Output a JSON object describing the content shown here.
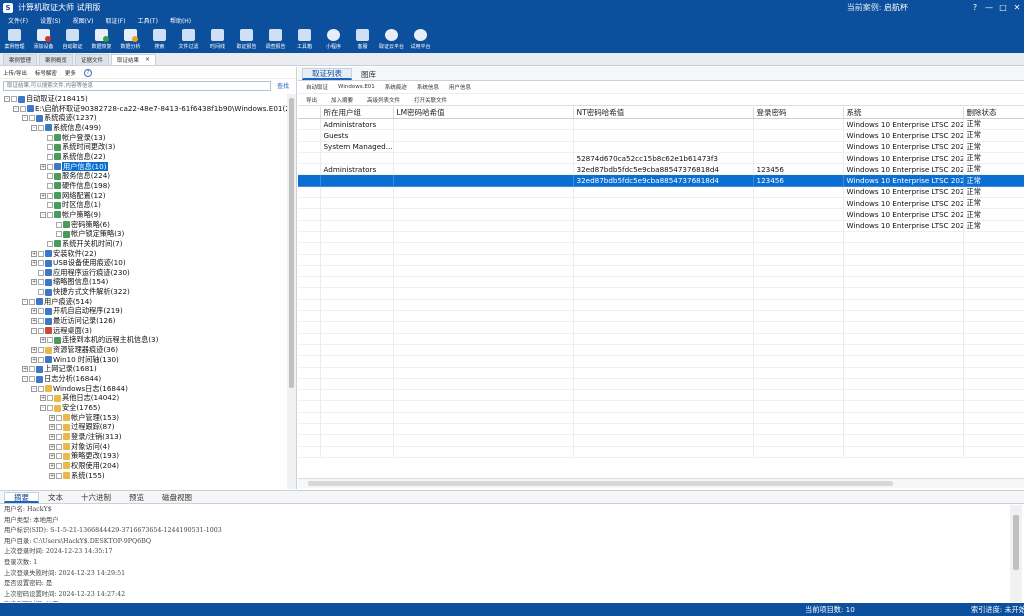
{
  "app": {
    "title": "计算机取证大师 试用版",
    "logo_letter": "S",
    "current_case_label": "当前案例:",
    "current_case_value": "启航杯",
    "window_buttons": [
      "?",
      "—",
      "□",
      "✕"
    ]
  },
  "menu": [
    "文件(F)",
    "设置(S)",
    "视图(V)",
    "取证(F)",
    "工具(T)",
    "帮助(H)"
  ],
  "toolbar": [
    {
      "label": "案例管理",
      "icon": "case-manage-icon",
      "variant": "b"
    },
    {
      "label": "添加设备",
      "icon": "add-device-icon",
      "variant": "r"
    },
    {
      "label": "自动取证",
      "icon": "auto-forensics-icon",
      "variant": "b"
    },
    {
      "label": "数据恢复",
      "icon": "data-recovery-icon",
      "variant": "g"
    },
    {
      "label": "数据分析",
      "icon": "data-analysis-icon",
      "variant": "o"
    },
    {
      "label": "搜索",
      "icon": "search-icon",
      "variant": "b"
    },
    {
      "label": "文件过滤",
      "icon": "file-filter-icon",
      "variant": "b"
    },
    {
      "label": "时间线",
      "icon": "timeline-icon",
      "variant": "b"
    },
    {
      "label": "取证报告",
      "icon": "forensics-report-icon",
      "variant": "b"
    },
    {
      "label": "调查报告",
      "icon": "investigation-report-icon",
      "variant": "b"
    },
    {
      "label": "工具箱",
      "icon": "toolbox-icon",
      "variant": "b"
    },
    {
      "label": "小程序",
      "icon": "mini-program-icon",
      "variant": "c"
    },
    {
      "label": "客服",
      "icon": "customer-service-icon",
      "variant": "b"
    },
    {
      "label": "取证云平台",
      "icon": "cloud-platform-icon",
      "variant": "c"
    },
    {
      "label": "试用平台",
      "icon": "trial-platform-icon",
      "variant": "c"
    }
  ],
  "doc_tabs": [
    {
      "label": "案例管理",
      "active": false
    },
    {
      "label": "案例概览",
      "active": false
    },
    {
      "label": "证据文件",
      "active": false
    },
    {
      "label": "取证结果",
      "active": true
    }
  ],
  "left_panel": {
    "tools": [
      "上传/导出",
      "标号解密",
      "更多"
    ],
    "search_placeholder": "取证结果,可以搜索文件,内容等信息",
    "search_button": "查找",
    "tree": [
      {
        "depth": 0,
        "ex": "-",
        "icon": "b",
        "label": "自动取证(218415)"
      },
      {
        "depth": 1,
        "ex": "-",
        "icon": "b",
        "label": "E:\\启航杯取证90382728-ca22-48e7-8413-61f6438f1b90\\Windows.E01(21"
      },
      {
        "depth": 2,
        "ex": "-",
        "icon": "b",
        "label": "系统痕迹(1237)"
      },
      {
        "depth": 3,
        "ex": "-",
        "icon": "b",
        "label": "系统信息(499)"
      },
      {
        "depth": 4,
        "ex": "",
        "icon": "g",
        "label": "帐户登录(13)"
      },
      {
        "depth": 4,
        "ex": "",
        "icon": "g",
        "label": "系统时间更改(3)"
      },
      {
        "depth": 4,
        "ex": "",
        "icon": "g",
        "label": "系统信息(22)"
      },
      {
        "depth": 4,
        "ex": "+",
        "icon": "b",
        "label": "用户信息(10)",
        "selected": true
      },
      {
        "depth": 4,
        "ex": "",
        "icon": "g",
        "label": "服务信息(224)"
      },
      {
        "depth": 4,
        "ex": "",
        "icon": "g",
        "label": "硬件信息(198)"
      },
      {
        "depth": 4,
        "ex": "+",
        "icon": "g",
        "label": "网络配置(12)"
      },
      {
        "depth": 4,
        "ex": "",
        "icon": "g",
        "label": "时区信息(1)"
      },
      {
        "depth": 4,
        "ex": "-",
        "icon": "g",
        "label": "帐户策略(9)"
      },
      {
        "depth": 5,
        "ex": "",
        "icon": "g",
        "label": "密码策略(6)"
      },
      {
        "depth": 5,
        "ex": "",
        "icon": "g",
        "label": "帐户锁定策略(3)"
      },
      {
        "depth": 4,
        "ex": "",
        "icon": "g",
        "label": "系统开关机时间(7)"
      },
      {
        "depth": 3,
        "ex": "+",
        "icon": "b",
        "label": "安装软件(22)"
      },
      {
        "depth": 3,
        "ex": "+",
        "icon": "b",
        "label": "USB设备使用痕迹(10)"
      },
      {
        "depth": 3,
        "ex": "",
        "icon": "b",
        "label": "应用程序运行痕迹(230)"
      },
      {
        "depth": 3,
        "ex": "+",
        "icon": "b",
        "label": "缩略图信息(154)"
      },
      {
        "depth": 3,
        "ex": "",
        "icon": "b",
        "label": "快捷方式文件解析(322)"
      },
      {
        "depth": 2,
        "ex": "-",
        "icon": "b",
        "label": "用户痕迹(514)"
      },
      {
        "depth": 3,
        "ex": "+",
        "icon": "b",
        "label": "开机自启动程序(219)"
      },
      {
        "depth": 3,
        "ex": "+",
        "icon": "b",
        "label": "最近访问记录(126)"
      },
      {
        "depth": 3,
        "ex": "-",
        "icon": "r",
        "label": "远程桌面(3)"
      },
      {
        "depth": 4,
        "ex": "+",
        "icon": "g",
        "label": "连接到本机的远程主机信息(3)"
      },
      {
        "depth": 3,
        "ex": "+",
        "icon": "y",
        "label": "资源管理器痕迹(36)"
      },
      {
        "depth": 3,
        "ex": "+",
        "icon": "b",
        "label": "Win10 时间轴(130)"
      },
      {
        "depth": 2,
        "ex": "+",
        "icon": "b",
        "label": "上网记录(1681)"
      },
      {
        "depth": 2,
        "ex": "-",
        "icon": "b",
        "label": "日志分析(16844)"
      },
      {
        "depth": 3,
        "ex": "-",
        "icon": "y",
        "label": "Windows日志(16844)"
      },
      {
        "depth": 4,
        "ex": "+",
        "icon": "y",
        "label": "其他日志(14042)"
      },
      {
        "depth": 4,
        "ex": "-",
        "icon": "y",
        "label": "安全(1765)"
      },
      {
        "depth": 5,
        "ex": "+",
        "icon": "y",
        "label": "帐户管理(153)"
      },
      {
        "depth": 5,
        "ex": "+",
        "icon": "y",
        "label": "过程跟踪(87)"
      },
      {
        "depth": 5,
        "ex": "+",
        "icon": "y",
        "label": "登录/注销(313)"
      },
      {
        "depth": 5,
        "ex": "+",
        "icon": "y",
        "label": "对象访问(4)"
      },
      {
        "depth": 5,
        "ex": "+",
        "icon": "y",
        "label": "策略更改(193)"
      },
      {
        "depth": 5,
        "ex": "+",
        "icon": "y",
        "label": "权限使用(204)"
      },
      {
        "depth": 5,
        "ex": "+",
        "icon": "y",
        "label": "系统(155)"
      }
    ]
  },
  "right_panel": {
    "tabs": [
      {
        "label": "取证列表",
        "active": true
      },
      {
        "label": "图库",
        "active": false
      }
    ],
    "breadcrumb": [
      "自动取证",
      "Windows.E01",
      "系统痕迹",
      "系统信息",
      "用户信息"
    ],
    "grid_tools": [
      "导出",
      "加入摘要",
      "高级列表文件",
      "打开关联文件"
    ],
    "columns": [
      "所在用户组",
      "LM密码哈希值",
      "NT密码哈希值",
      "登录密码",
      "系统",
      "删除状态"
    ],
    "rows": [
      {
        "cells": [
          "Administrators",
          "",
          "",
          "",
          "Windows 10 Enterprise LTSC 2021",
          "正常"
        ],
        "selected": false
      },
      {
        "cells": [
          "Guests",
          "",
          "",
          "",
          "Windows 10 Enterprise LTSC 2021",
          "正常"
        ],
        "selected": false
      },
      {
        "cells": [
          "System Managed...",
          "",
          "",
          "",
          "Windows 10 Enterprise LTSC 2021",
          "正常"
        ],
        "selected": false
      },
      {
        "cells": [
          "",
          "",
          "52874d670ca52cc15b8c62e1b61473f3",
          "",
          "Windows 10 Enterprise LTSC 2021",
          "正常"
        ],
        "selected": false
      },
      {
        "cells": [
          "Administrators",
          "",
          "32ed87bdb5fdc5e9cba88547376818d4",
          "123456",
          "Windows 10 Enterprise LTSC 2021",
          "正常"
        ],
        "selected": false
      },
      {
        "cells": [
          "",
          "",
          "32ed87bdb5fdc5e9cba88547376818d4",
          "123456",
          "Windows 10 Enterprise LTSC 2021",
          "正常"
        ],
        "selected": true
      },
      {
        "cells": [
          "",
          "",
          "",
          "",
          "Windows 10 Enterprise LTSC 2021",
          "正常"
        ],
        "selected": false
      },
      {
        "cells": [
          "",
          "",
          "",
          "",
          "Windows 10 Enterprise LTSC 2021",
          "正常"
        ],
        "selected": false
      },
      {
        "cells": [
          "",
          "",
          "",
          "",
          "Windows 10 Enterprise LTSC 2021",
          "正常"
        ],
        "selected": false
      },
      {
        "cells": [
          "",
          "",
          "",
          "",
          "Windows 10 Enterprise LTSC 2021",
          "正常"
        ],
        "selected": false
      }
    ],
    "empty_rows": 20
  },
  "bottom_panel": {
    "tabs": [
      {
        "label": "摘要",
        "active": true
      },
      {
        "label": "文本",
        "active": false
      },
      {
        "label": "十六进制",
        "active": false
      },
      {
        "label": "预览",
        "active": false
      },
      {
        "label": "磁盘视图",
        "active": false
      }
    ],
    "summary_lines": [
      "用户名: HackY$",
      "用户类型: 本地用户",
      "用户标识(SID): S-1-5-21-1366844429-3716673654-1244190531-1003",
      "用户目录: C:\\Users\\HackY$.DESKTOP-9PQ6BQ",
      "上次登录时间: 2024-12-23 14:35:17",
      "登录次数: 1",
      "上次登录失败时间: 2024-12-23 14:29:51",
      "是否设置密码: 是",
      "上次密码设置时间: 2024-12-23 14:27:42",
      "账户到期时间: 从不"
    ]
  },
  "status": {
    "item_count": "当前项目数: 10",
    "index_progress": "索引进度: 未开始"
  }
}
